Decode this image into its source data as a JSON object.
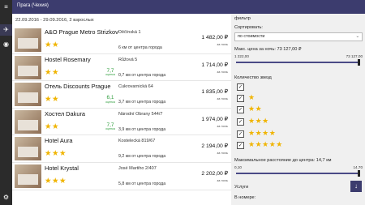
{
  "header": {
    "title": "Прага (Чехия)"
  },
  "list": {
    "subtitle": "22.09.2016 - 29.09.2016, 2 взрослых",
    "hotels": [
      {
        "name": "A&O Prague Metro Strizkov",
        "stars": "★★",
        "address": "Děčínská 1",
        "distance": "6 км от центра города",
        "rating": "",
        "rating_label": "",
        "price": "1 482,00 ₽",
        "per_night": "за ночь"
      },
      {
        "name": "Hostel Rosemary",
        "stars": "★★",
        "address": "Růžová 5",
        "distance": "0,7 км от центра города",
        "rating": "7,7",
        "rating_label": "оценка",
        "price": "1 714,00 ₽",
        "per_night": "за ночь"
      },
      {
        "name": "Отель Discounts Prague",
        "stars": "★★",
        "address": "Cukrovarnická 64",
        "distance": "3,7 км от центра города",
        "rating": "6,1",
        "rating_label": "оценка",
        "price": "1 835,00 ₽",
        "per_night": "за ночь"
      },
      {
        "name": "Хостел Dakura",
        "stars": "★★",
        "address": "Národní Obrany 544/7",
        "distance": "3,9 км от центра города",
        "rating": "7,7",
        "rating_label": "оценка",
        "price": "1 974,00 ₽",
        "per_night": "за ночь"
      },
      {
        "name": "Hotel Aura",
        "stars": "★★★",
        "address": "Kostelecká 819/67",
        "distance": "9,2 км от центра города",
        "rating": "",
        "rating_label": "",
        "price": "2 194,00 ₽",
        "per_night": "за ночь"
      },
      {
        "name": "Hotel Krystal",
        "stars": "★★★",
        "address": "José Martiho 2/407",
        "distance": "5,8 км от центра города",
        "rating": "",
        "rating_label": "",
        "price": "2 202,00 ₽",
        "per_night": "за ночь"
      }
    ]
  },
  "filter": {
    "title": "фильтр",
    "sort_label": "Сортировать:",
    "sort_value": "по стоимости",
    "price_label": "Макс. цена за ночь: 73 127,00 ₽",
    "price_min": "1 222,00",
    "price_max": "73 127,00",
    "price_level": 1.0,
    "stars_label": "Количество звезд",
    "star_options": [
      {
        "stars": "",
        "checked": "✓"
      },
      {
        "stars": "★",
        "checked": "✓"
      },
      {
        "stars": "★★",
        "checked": "✓"
      },
      {
        "stars": "★★★",
        "checked": "✓"
      },
      {
        "stars": "★★★★",
        "checked": "✓"
      },
      {
        "stars": "★★★★★",
        "checked": "✓"
      }
    ],
    "distance_label": "Максимальное расстояние до центра: 14,7 км",
    "distance_min": "0,10",
    "distance_max": "14,70",
    "distance_level": 1.0,
    "services_label": "Услуги",
    "in_room_label": "В номере:",
    "scroll_icon": "↓"
  },
  "rail": {
    "icons": [
      "≡",
      "✈",
      "◉",
      "⚙"
    ]
  },
  "colors": {
    "header": "#3c3c6e",
    "rail": "#2b2b2b",
    "star": "#f0b400",
    "rating": "#2d9c3b",
    "accent": "#4a4a86"
  }
}
